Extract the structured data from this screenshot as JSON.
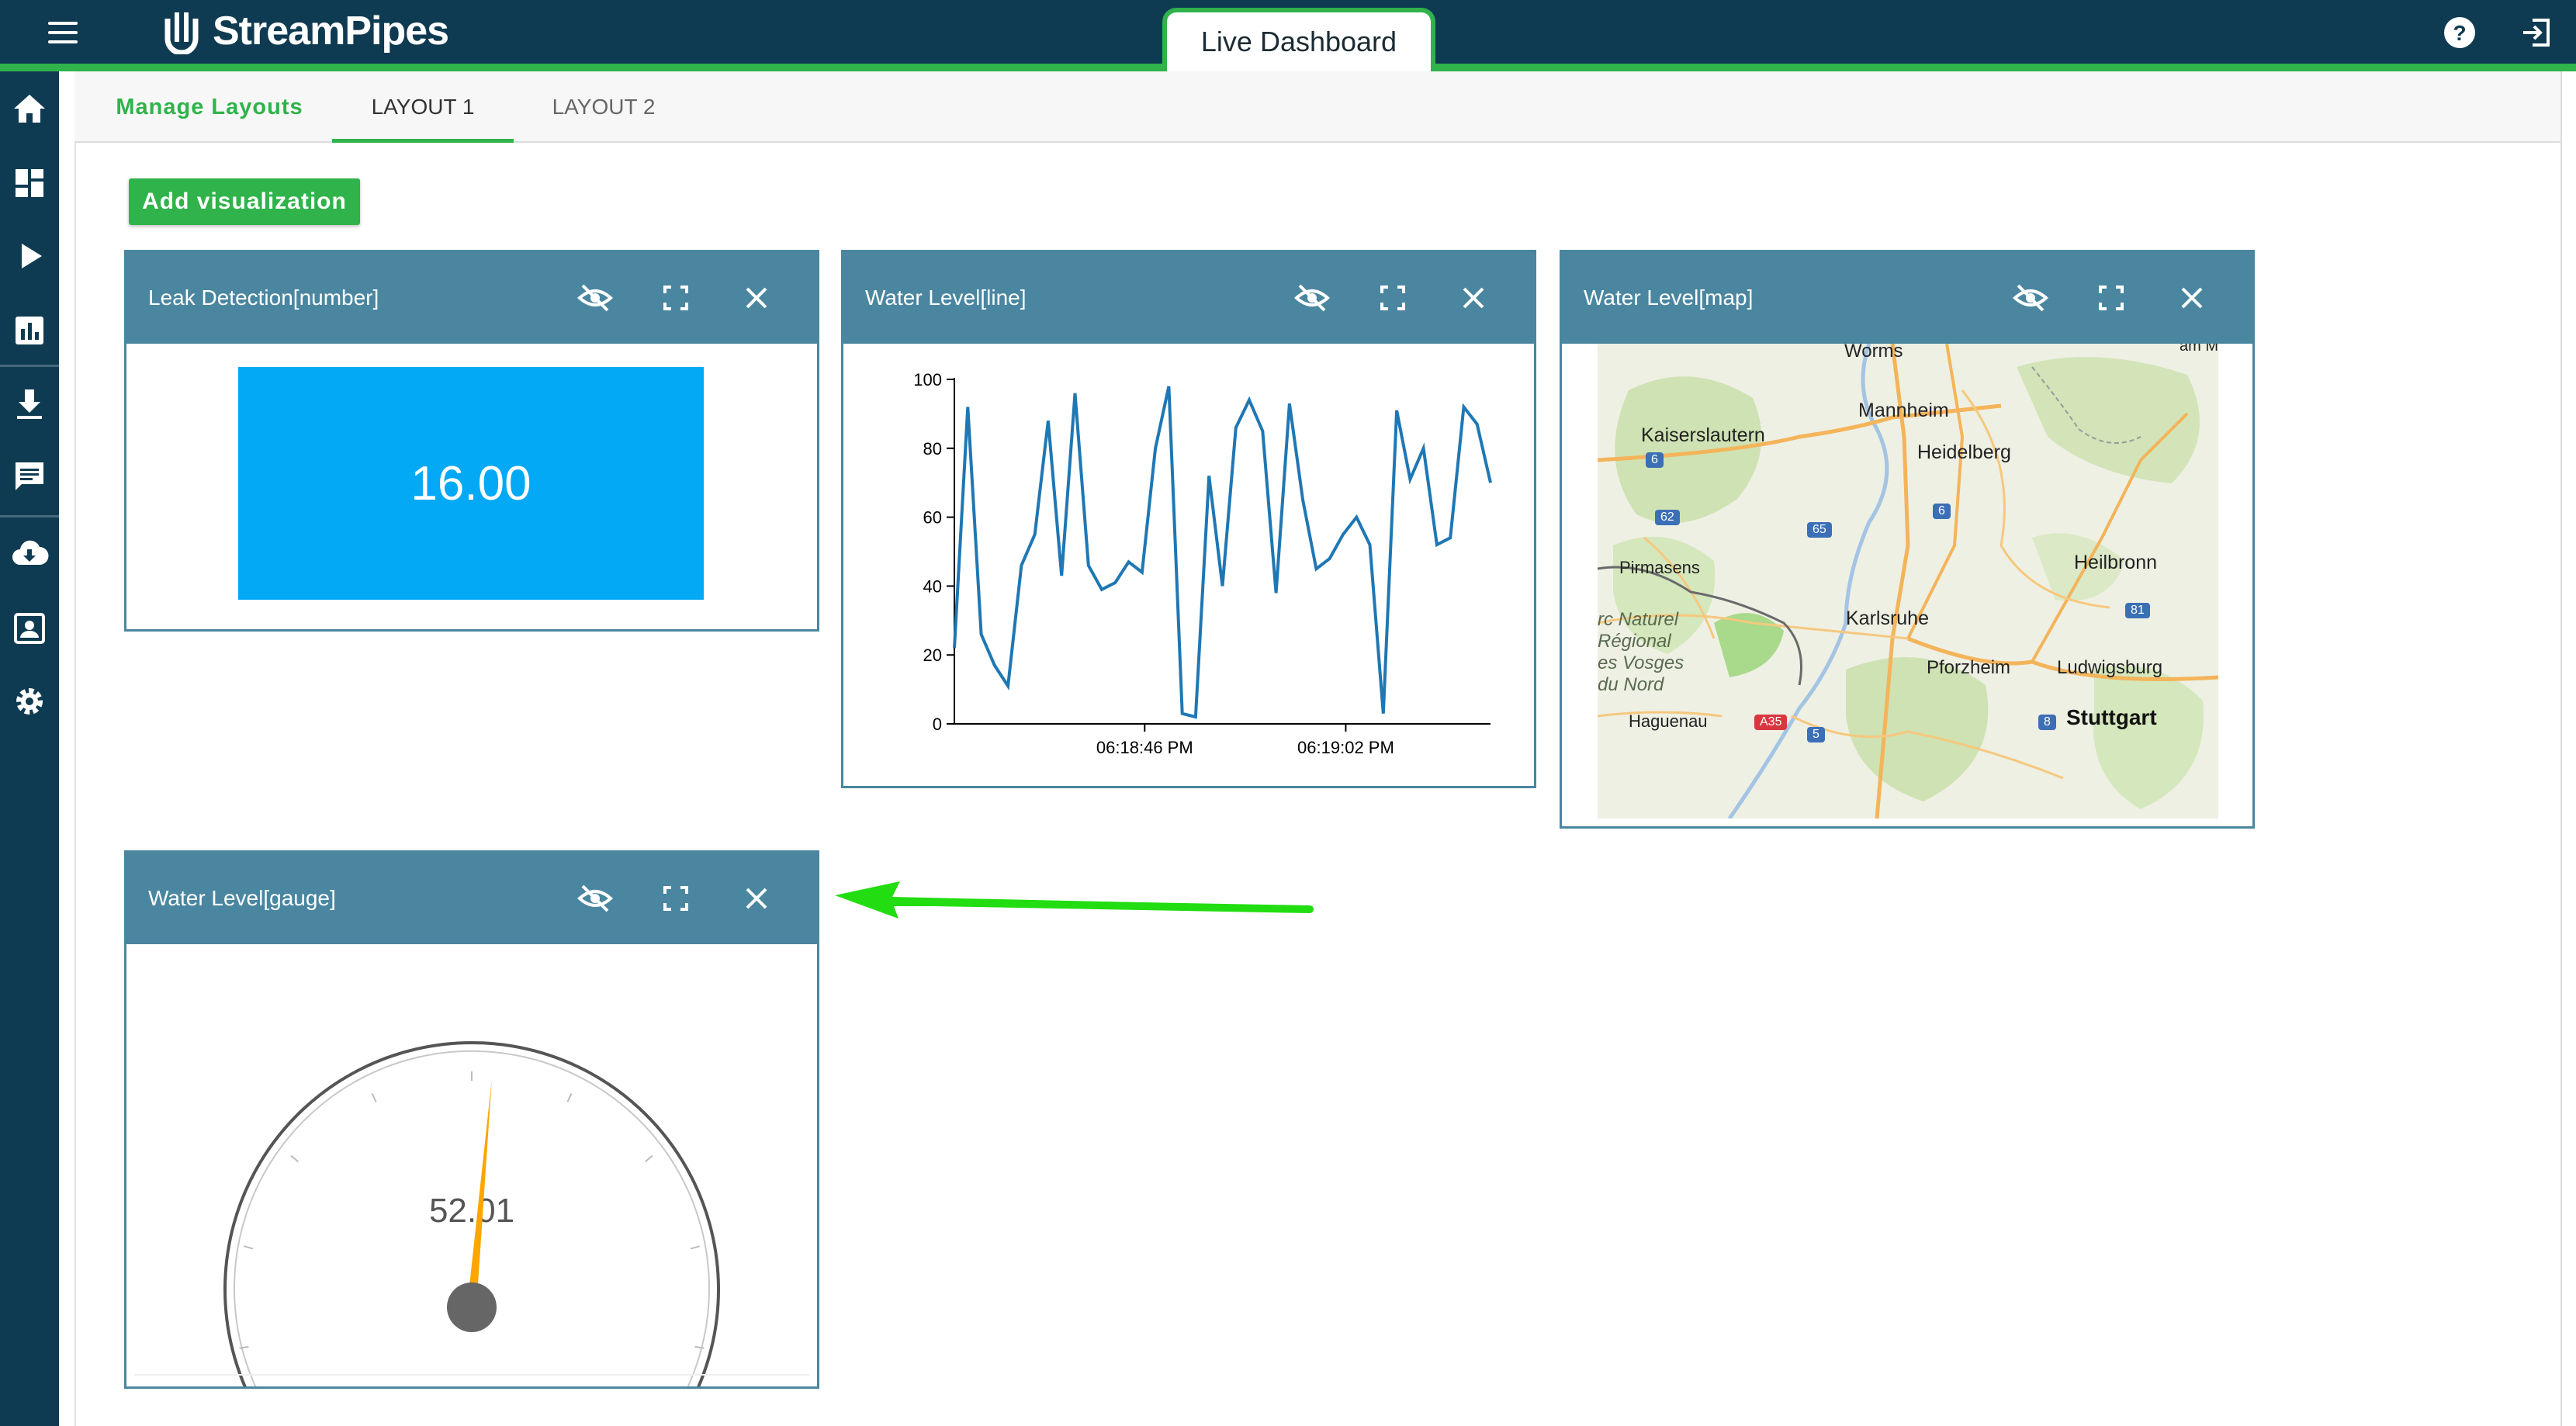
{
  "app": {
    "name": "StreamPipes",
    "view_title": "Live Dashboard"
  },
  "header": {
    "menu_icon": "menu-icon",
    "help_icon": "help-icon",
    "logout_icon": "logout-icon"
  },
  "sidebar": {
    "items": [
      {
        "icon": "home-icon"
      },
      {
        "icon": "dashboard-icon"
      },
      {
        "icon": "play-icon"
      },
      {
        "icon": "bar-chart-icon"
      },
      {
        "icon": "download-icon"
      },
      {
        "icon": "message-icon"
      },
      {
        "icon": "cloud-download-icon"
      },
      {
        "icon": "contacts-icon"
      },
      {
        "icon": "settings-icon"
      }
    ]
  },
  "tabs": {
    "manage": "Manage Layouts",
    "items": [
      {
        "label": "LAYOUT 1",
        "active": true
      },
      {
        "label": "LAYOUT 2",
        "active": false
      }
    ]
  },
  "add_visualization": "Add visualization",
  "widgets": {
    "number": {
      "title": "Leak Detection[number]",
      "value": "16.00",
      "color": "#03a9f4"
    },
    "line": {
      "title": "Water Level[line]",
      "y_ticks": [
        "100",
        "80",
        "60",
        "40",
        "20",
        "0"
      ],
      "x_ticks": [
        "06:18:46 PM",
        "06:19:02 PM"
      ]
    },
    "map": {
      "title": "Water Level[map]",
      "places": [
        "Worms",
        "Mannheim",
        "Kaiserslautern",
        "Heidelberg",
        "Pirmasens",
        "Heilbronn",
        "Karlsruhe",
        "Pforzheim",
        "Ludwigsburg",
        "Stuttgart",
        "Haguenau",
        "rc Naturel",
        "Régional",
        "es Vosges",
        "du Nord",
        "am M"
      ],
      "road_shields": [
        "6",
        "62",
        "65",
        "6",
        "81",
        "8",
        "5",
        "A35"
      ]
    },
    "gauge": {
      "title": "Water Level[gauge]",
      "value": "52.01",
      "needle_color": "#ffa500"
    }
  },
  "widget_buttons": {
    "hide_icon": "visibility-off-icon",
    "expand_icon": "fullscreen-icon",
    "close_icon": "close-icon"
  },
  "annotation": {
    "arrow_color": "#22dd11"
  },
  "chart_data": {
    "type": "line",
    "title": "",
    "xlabel": "",
    "ylabel": "",
    "ylim": [
      0,
      100
    ],
    "x_tick_labels": [
      "06:18:46 PM",
      "06:19:02 PM"
    ],
    "values": [
      22,
      92,
      26,
      17,
      11,
      46,
      55,
      88,
      43,
      96,
      46,
      39,
      41,
      47,
      44,
      80,
      98,
      3,
      2,
      72,
      40,
      86,
      94,
      85,
      38,
      93,
      65,
      45,
      48,
      55,
      60,
      52,
      3,
      91,
      71,
      80,
      52,
      54,
      92,
      87,
      70
    ],
    "series": [
      {
        "values": [
          22,
          92,
          26,
          17,
          11,
          46,
          55,
          88,
          43,
          96,
          46,
          39,
          41,
          47,
          44,
          80,
          98,
          3,
          2,
          72,
          40,
          86,
          94,
          85,
          38,
          93,
          65,
          45,
          48,
          55,
          60,
          52,
          3,
          91,
          71,
          80,
          52,
          54,
          92,
          87,
          70
        ]
      }
    ]
  }
}
